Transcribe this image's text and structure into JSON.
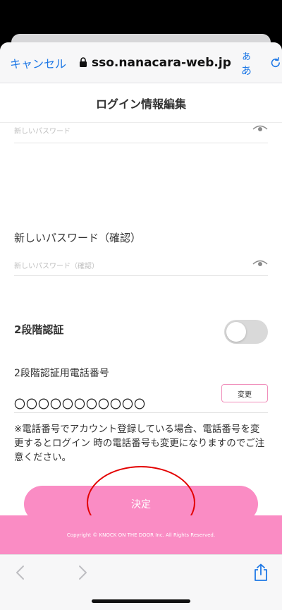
{
  "browser": {
    "cancel_label": "キャンセル",
    "url": "sso.nanacara-web.jp",
    "text_size_label": "ぁあ"
  },
  "page": {
    "title": "ログイン情報編集"
  },
  "form": {
    "new_password_placeholder": "新しいパスワード",
    "confirm_label": "新しいパスワード（確認）",
    "confirm_placeholder": "新しいパスワード（確認）",
    "two_factor_label": "2段階認証",
    "two_factor_enabled": false,
    "phone_label": "2段階認証用電話番号",
    "phone_value": "〇〇〇〇〇〇〇〇〇〇〇",
    "change_button": "変更",
    "notice": "※電話番号でアカウント登録している場合、電話番号を変更するとログイン 時の電話番号も変更になりますのでご注意ください。",
    "submit_button": "決定"
  },
  "footer": {
    "copyright": "Copyright © KNOCK ON THE DOOR Inc. All Rights Reserved."
  },
  "colors": {
    "accent_pink": "#fa8cc4",
    "ios_blue": "#1e78e6",
    "annotation_red": "#e30000"
  },
  "icons": [
    "lock-icon",
    "reload-icon",
    "eye-icon",
    "back-arrow-icon",
    "forward-arrow-icon",
    "share-icon"
  ]
}
